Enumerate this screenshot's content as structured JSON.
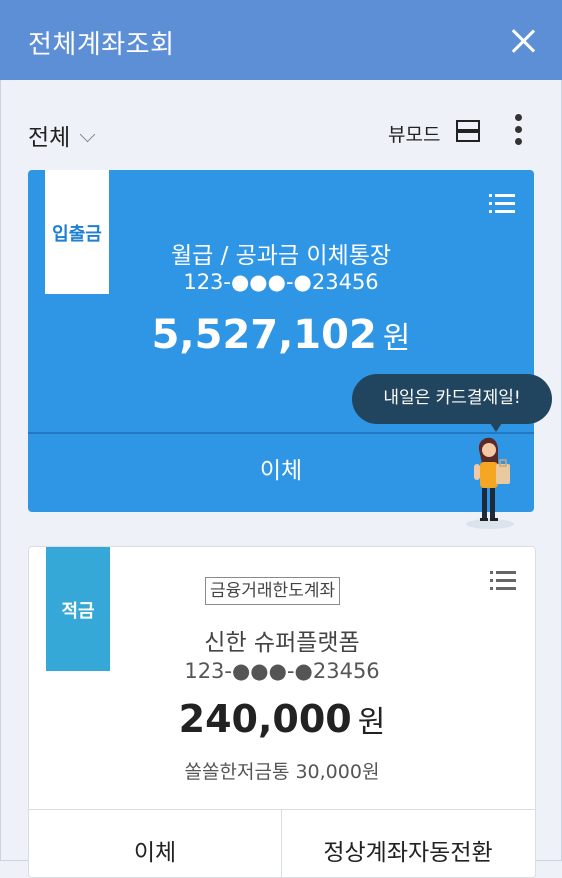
{
  "header": {
    "title": "전체계좌조회",
    "close_icon": "close-icon"
  },
  "toolbar": {
    "filter_label": "전체",
    "view_mode_label": "뷰모드",
    "view_icon": "list-view-icon",
    "more_icon": "more-vertical-icon"
  },
  "accounts": [
    {
      "type_tag": "입출금",
      "name": "월급 / 공과금 이체통장",
      "number": "123-●●●-●23456",
      "balance": "5,527,102",
      "unit": "원",
      "transfer_label": "이체",
      "card_color": "#2f96e6"
    },
    {
      "type_tag": "적금",
      "badge": "금융거래한도계좌",
      "name": "신한 슈퍼플랫폼",
      "number": "123-●●●-●23456",
      "balance": "240,000",
      "unit": "원",
      "sub_info": "쏠쏠한저금통 30,000원",
      "transfer_label": "이체",
      "convert_label": "정상계좌자동전환",
      "tag_color": "#35a8d7"
    }
  ],
  "promo": {
    "message": "내일은 카드결제일!"
  }
}
